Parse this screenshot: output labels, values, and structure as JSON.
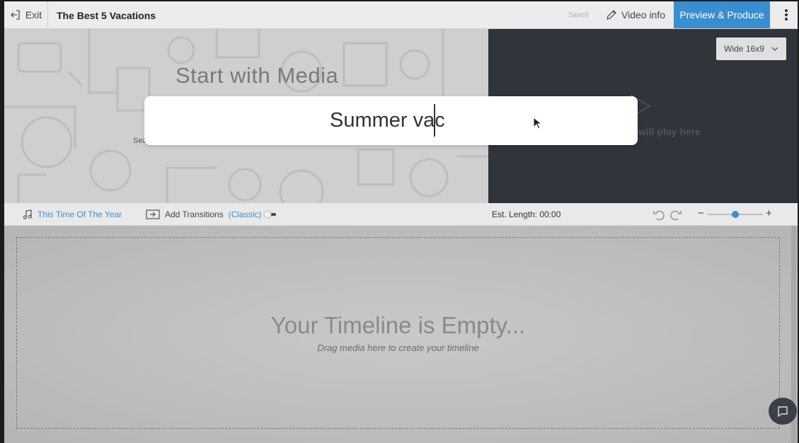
{
  "header": {
    "exit_label": "Exit",
    "project_title": "The Best 5 Vacations",
    "saved_status": "Saved",
    "video_info_label": "Video info",
    "preview_label": "Preview & Produce",
    "menu_icon": "kebab-icon"
  },
  "media": {
    "start_heading": "Start with Media",
    "search_label_fragment": "Sea",
    "player_text": "will play here",
    "aspect_selected": "Wide 16x9"
  },
  "search": {
    "value": "Summer vac"
  },
  "toolbar": {
    "music_title": "This Time Of The Year",
    "transitions_label": "Add Transitions",
    "transitions_mode": "(Classic)",
    "est_length": "Est. Length: 00:00",
    "zoom_minus": "−",
    "zoom_plus": "+",
    "zoom_level": 0.5
  },
  "timeline": {
    "empty_title": "Your Timeline is Empty...",
    "empty_subtitle": "Drag media here to create your timeline"
  },
  "colors": {
    "accent": "#3a8ed0",
    "player_bg": "#30343b"
  }
}
